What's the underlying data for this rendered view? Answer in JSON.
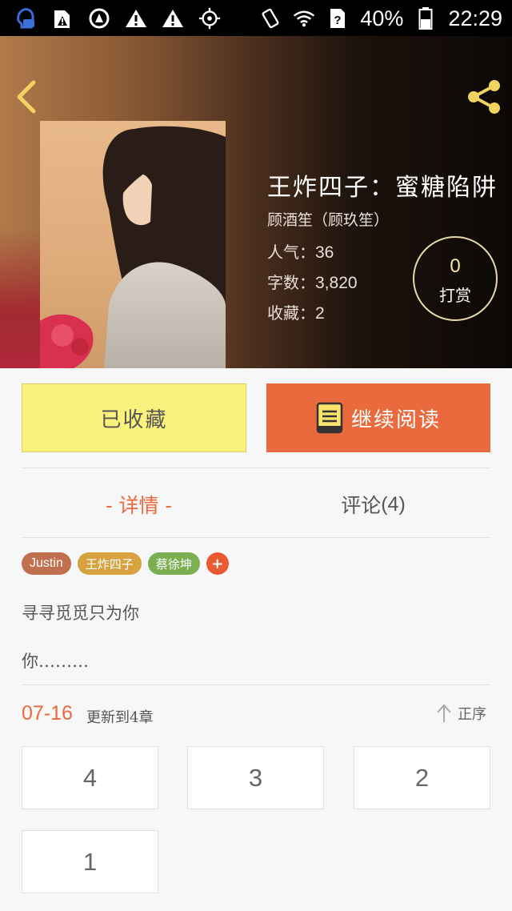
{
  "status_bar": {
    "battery": "40%",
    "time": "22:29"
  },
  "book": {
    "title": "王炸四子：蜜糖陷阱",
    "author": "顾酒笙（顾玖笙）",
    "popularity_label": "人气：",
    "popularity": "36",
    "word_count_label": "字数：",
    "word_count": "3,820",
    "favorites_label": "收藏：",
    "favorites": "2",
    "reward_count": "0",
    "reward_label": "打赏"
  },
  "actions": {
    "collected_label": "已收藏",
    "continue_label": "继续阅读"
  },
  "tabs": {
    "details": "- 详情 -",
    "comments": "评论",
    "comments_count": "(4)"
  },
  "tags": [
    "Justin",
    "王炸四子",
    "蔡徐坤"
  ],
  "tag_add": "+",
  "description": {
    "line1": "寻寻觅觅只为你",
    "line2": "你………"
  },
  "update": {
    "date": "07-16",
    "text": "更新到4章",
    "sort_label": "正序"
  },
  "chapters": [
    "4",
    "3",
    "2",
    "1"
  ],
  "colors": {
    "accent": "#ea6a3d",
    "collected_bg": "#faf27c",
    "tag_justin": "#c0704e",
    "tag_wangzha": "#d7a240",
    "tag_caixukun": "#7cae52"
  }
}
